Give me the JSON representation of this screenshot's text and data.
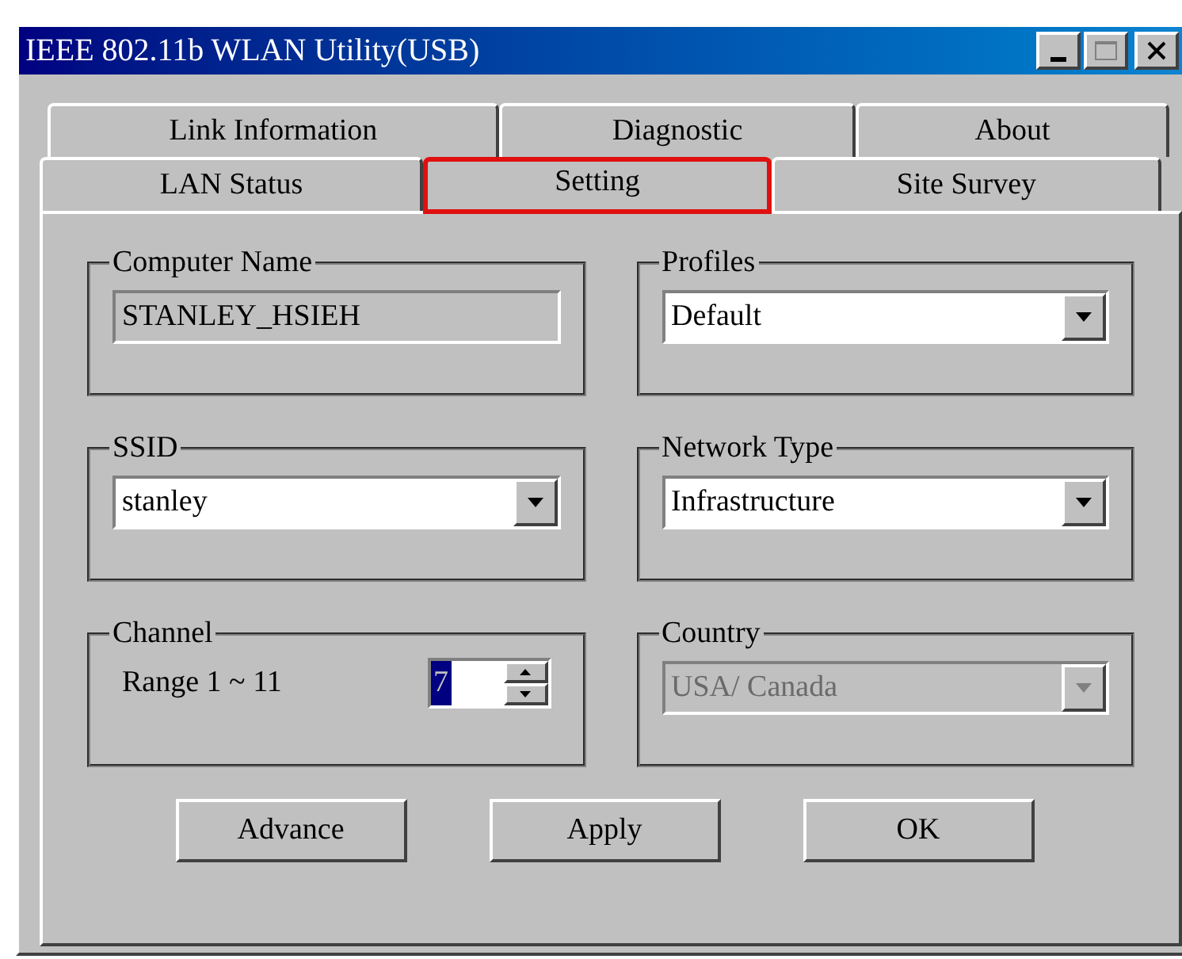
{
  "window": {
    "title": "IEEE 802.11b WLAN Utility(USB)"
  },
  "tab_rows": [
    {
      "tabs": [
        {
          "label": "Link Information",
          "selected": false,
          "highlighted": false
        },
        {
          "label": "Diagnostic",
          "selected": false,
          "highlighted": false
        },
        {
          "label": "About",
          "selected": false,
          "highlighted": false
        }
      ]
    },
    {
      "tabs": [
        {
          "label": "LAN Status",
          "selected": false,
          "highlighted": false
        },
        {
          "label": "Setting",
          "selected": true,
          "highlighted": true
        },
        {
          "label": "Site Survey",
          "selected": false,
          "highlighted": false
        }
      ]
    }
  ],
  "groups": [
    {
      "kind": "text",
      "label": "Computer Name",
      "value": "STANLEY_HSIEH",
      "disabled": true
    },
    {
      "kind": "dropdown",
      "label": "Profiles",
      "value": "Default",
      "disabled": false
    },
    {
      "kind": "dropdown",
      "label": "SSID",
      "value": "stanley",
      "disabled": false
    },
    {
      "kind": "dropdown",
      "label": "Network Type",
      "value": "Infrastructure",
      "disabled": false
    },
    {
      "kind": "spin",
      "label": "Channel",
      "range": "Range 1 ~ 11",
      "value": "7",
      "value_selected": true
    },
    {
      "kind": "dropdown",
      "label": "Country",
      "value": "USA/ Canada",
      "disabled": true
    }
  ],
  "buttons": [
    "Advance",
    "Apply",
    "OK"
  ]
}
